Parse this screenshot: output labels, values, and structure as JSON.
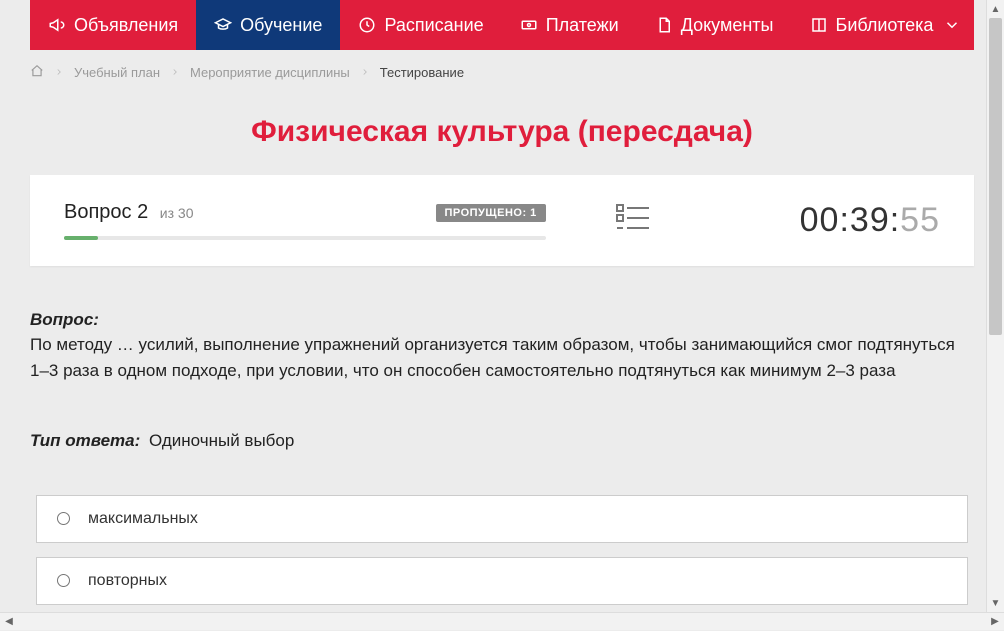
{
  "nav": {
    "items": [
      {
        "label": "Объявления"
      },
      {
        "label": "Обучение"
      },
      {
        "label": "Расписание"
      },
      {
        "label": "Платежи"
      },
      {
        "label": "Документы"
      },
      {
        "label": "Библиотека"
      }
    ],
    "active_index": 1
  },
  "breadcrumbs": {
    "items": [
      {
        "label": "Учебный план"
      },
      {
        "label": "Мероприятие дисциплины"
      },
      {
        "label": "Тестирование"
      }
    ]
  },
  "page_title": "Физическая культура (пересдача)",
  "test_status": {
    "question_label": "Вопрос 2",
    "total_label": "из 30",
    "skipped_label": "ПРОПУЩЕНО: 1",
    "progress_percent": 7,
    "timer_main": "00:39:",
    "timer_sub": "55"
  },
  "question": {
    "prompt_label": "Вопрос:",
    "text": "По методу … усилий, выполнение упражнений организуется таким образом, чтобы занимающийся смог подтянуться 1–3 раза в одном подходе, при условии, что он способен самостоятельно подтянуться как минимум 2–3 раза"
  },
  "answer_type": {
    "label": "Тип ответа:",
    "value": "Одиночный выбор"
  },
  "options": [
    {
      "label": "максимальных"
    },
    {
      "label": "повторных"
    }
  ]
}
